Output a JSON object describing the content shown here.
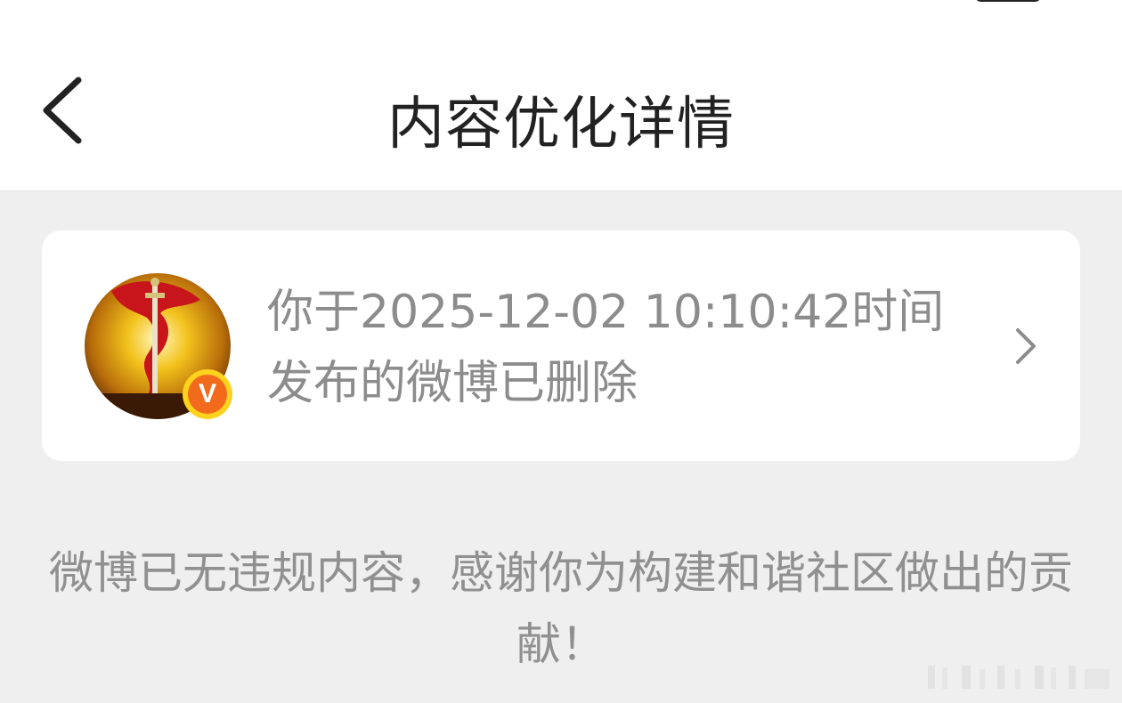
{
  "navbar": {
    "title": "内容优化详情",
    "back_icon": "chevron-left-icon"
  },
  "card": {
    "message": "你于2025-12-02 10:10:42时间发布的微博已删除",
    "badge_label": "V",
    "chevron_icon": "chevron-right-icon"
  },
  "notice": {
    "text": "微博已无违规内容，感谢你为构建和谐社区做出的贡献！"
  },
  "colors": {
    "background": "#efefef",
    "card": "#ffffff",
    "title": "#222222",
    "secondary_text": "#8c8c8c",
    "badge_orange": "#f26b1d",
    "badge_ring": "#ffd21e"
  }
}
